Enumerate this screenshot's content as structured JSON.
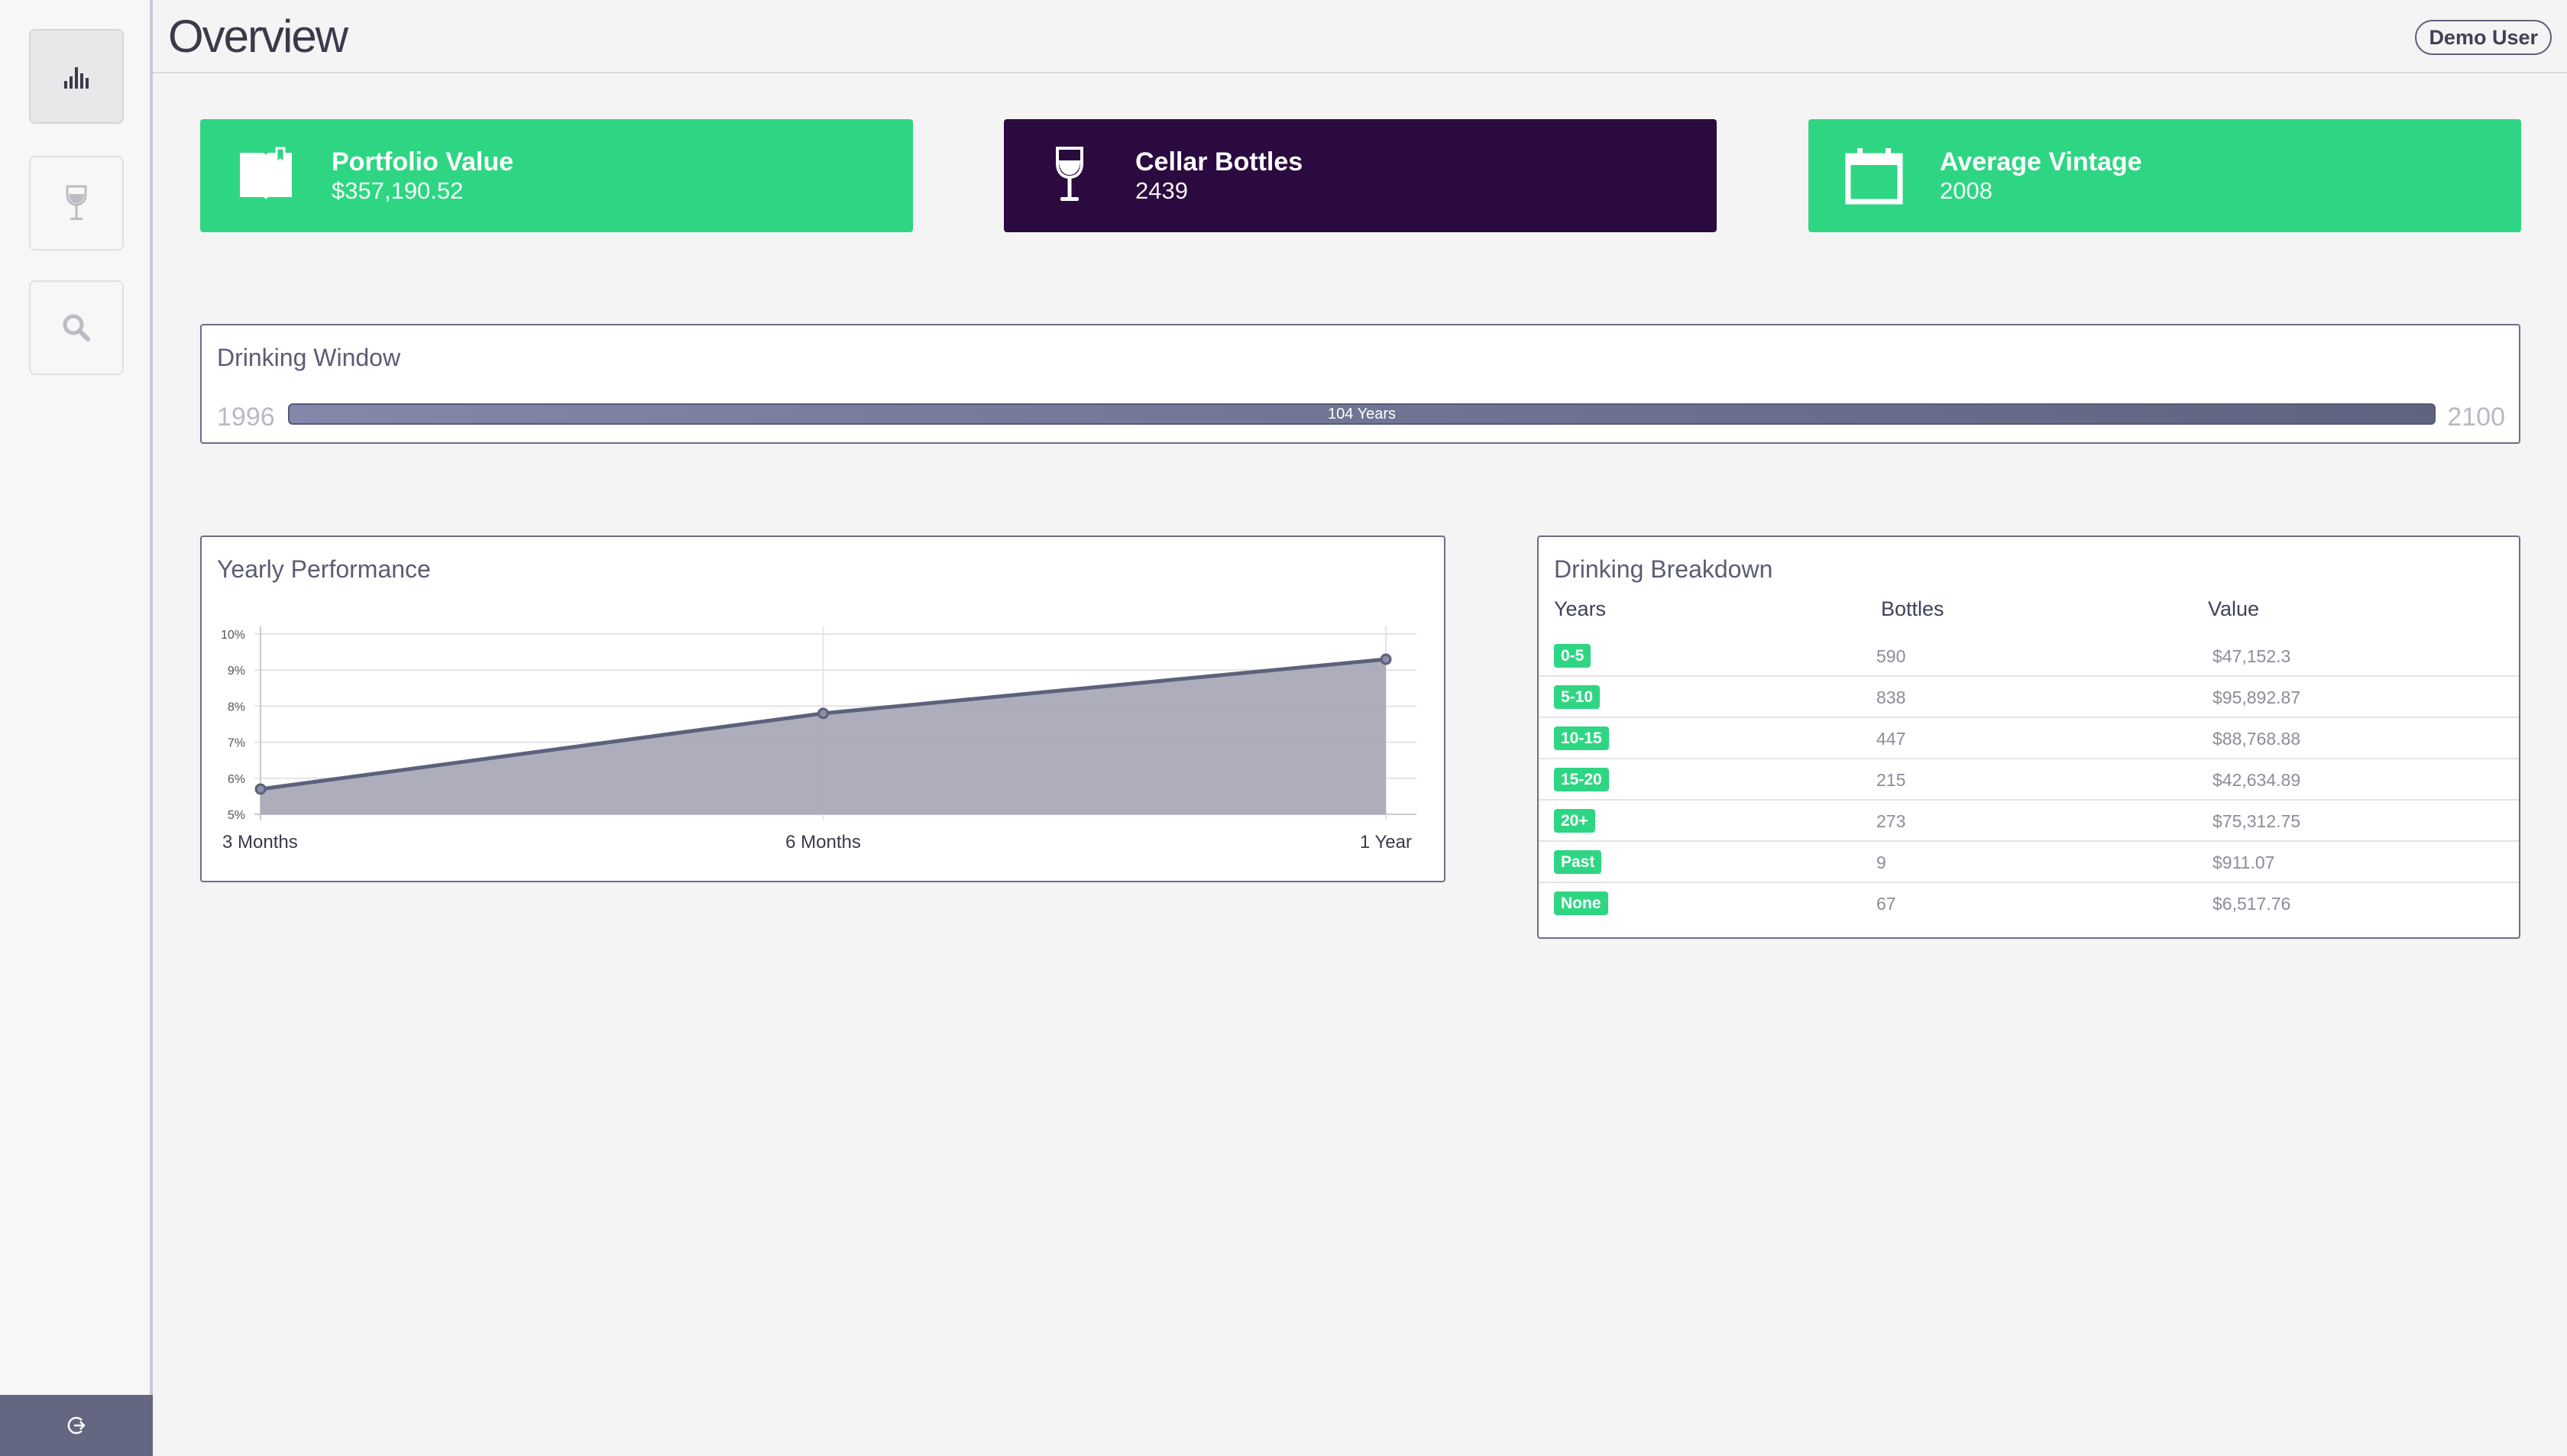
{
  "header": {
    "title": "Overview",
    "user": "Demo User"
  },
  "sidebar": {
    "items": [
      {
        "name": "overview",
        "icon": "bar-chart-icon",
        "active": true
      },
      {
        "name": "cellar",
        "icon": "wine-glass-icon",
        "active": false
      },
      {
        "name": "search",
        "icon": "search-icon",
        "active": false
      }
    ],
    "logout_icon": "logout-icon"
  },
  "stats": [
    {
      "label": "Portfolio Value",
      "value": "$357,190.52",
      "icon": "book-icon",
      "color": "#2ed683"
    },
    {
      "label": "Cellar Bottles",
      "value": "2439",
      "icon": "wine-glass-icon",
      "color": "#2a0a3f"
    },
    {
      "label": "Average Vintage",
      "value": "2008",
      "icon": "calendar-icon",
      "color": "#2ed683"
    }
  ],
  "drinking_window": {
    "title": "Drinking Window",
    "start": "1996",
    "end": "2100",
    "span_label": "104 Years"
  },
  "yearly_performance": {
    "title": "Yearly Performance"
  },
  "chart_data": {
    "type": "area",
    "title": "Yearly Performance",
    "categories": [
      "3 Months",
      "6 Months",
      "1 Year"
    ],
    "values": [
      5.7,
      7.8,
      9.3
    ],
    "yticks": [
      "10%",
      "9%",
      "8%",
      "7%",
      "6%",
      "5%"
    ],
    "ylim": [
      5,
      10
    ],
    "grid": true,
    "colors": {
      "line": "#5d617b",
      "fill": "#a9a9b8"
    }
  },
  "drinking_breakdown": {
    "title": "Drinking Breakdown",
    "columns": [
      "Years",
      "Bottles",
      "Value"
    ],
    "rows": [
      {
        "years": "0-5",
        "bottles": "590",
        "value": "$47,152.3"
      },
      {
        "years": "5-10",
        "bottles": "838",
        "value": "$95,892.87"
      },
      {
        "years": "10-15",
        "bottles": "447",
        "value": "$88,768.88"
      },
      {
        "years": "15-20",
        "bottles": "215",
        "value": "$42,634.89"
      },
      {
        "years": "20+",
        "bottles": "273",
        "value": "$75,312.75"
      },
      {
        "years": "Past",
        "bottles": "9",
        "value": "$911.07"
      },
      {
        "years": "None",
        "bottles": "67",
        "value": "$6,517.76"
      }
    ]
  }
}
